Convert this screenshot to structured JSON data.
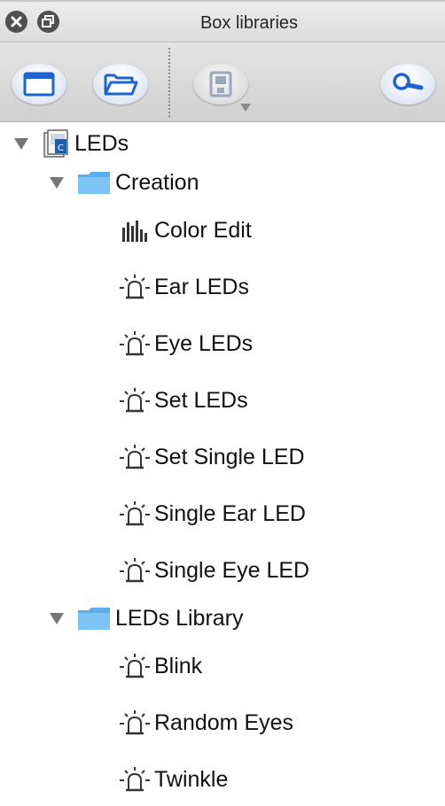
{
  "window": {
    "title": "Box libraries"
  },
  "toolbar": {
    "buttons": [
      {
        "icon": "new-window-icon",
        "enabled": true
      },
      {
        "icon": "open-folder-icon",
        "enabled": true
      },
      {
        "icon": "save-icon",
        "enabled": false
      },
      {
        "icon": "search-icon",
        "enabled": true
      }
    ]
  },
  "tree": {
    "root": {
      "label": "LEDs",
      "icon": "library-icon",
      "expanded": true,
      "folders": [
        {
          "label": "Creation",
          "icon": "folder-icon",
          "expanded": true,
          "items": [
            {
              "label": "Color Edit",
              "icon": "bar-chart-icon"
            },
            {
              "label": "Ear LEDs",
              "icon": "led-icon"
            },
            {
              "label": "Eye LEDs",
              "icon": "led-icon"
            },
            {
              "label": "Set LEDs",
              "icon": "led-icon"
            },
            {
              "label": "Set Single LED",
              "icon": "led-icon"
            },
            {
              "label": "Single Ear LED",
              "icon": "led-icon"
            },
            {
              "label": "Single Eye LED",
              "icon": "led-icon"
            }
          ]
        },
        {
          "label": "LEDs Library",
          "icon": "folder-icon",
          "expanded": true,
          "items": [
            {
              "label": "Blink",
              "icon": "led-icon"
            },
            {
              "label": "Random Eyes",
              "icon": "led-icon"
            },
            {
              "label": "Twinkle",
              "icon": "led-icon"
            }
          ]
        }
      ]
    }
  },
  "colors": {
    "folder": "#6ab8f0",
    "toolbar_icon": "#1e63d4",
    "disclosure": "#777777"
  }
}
